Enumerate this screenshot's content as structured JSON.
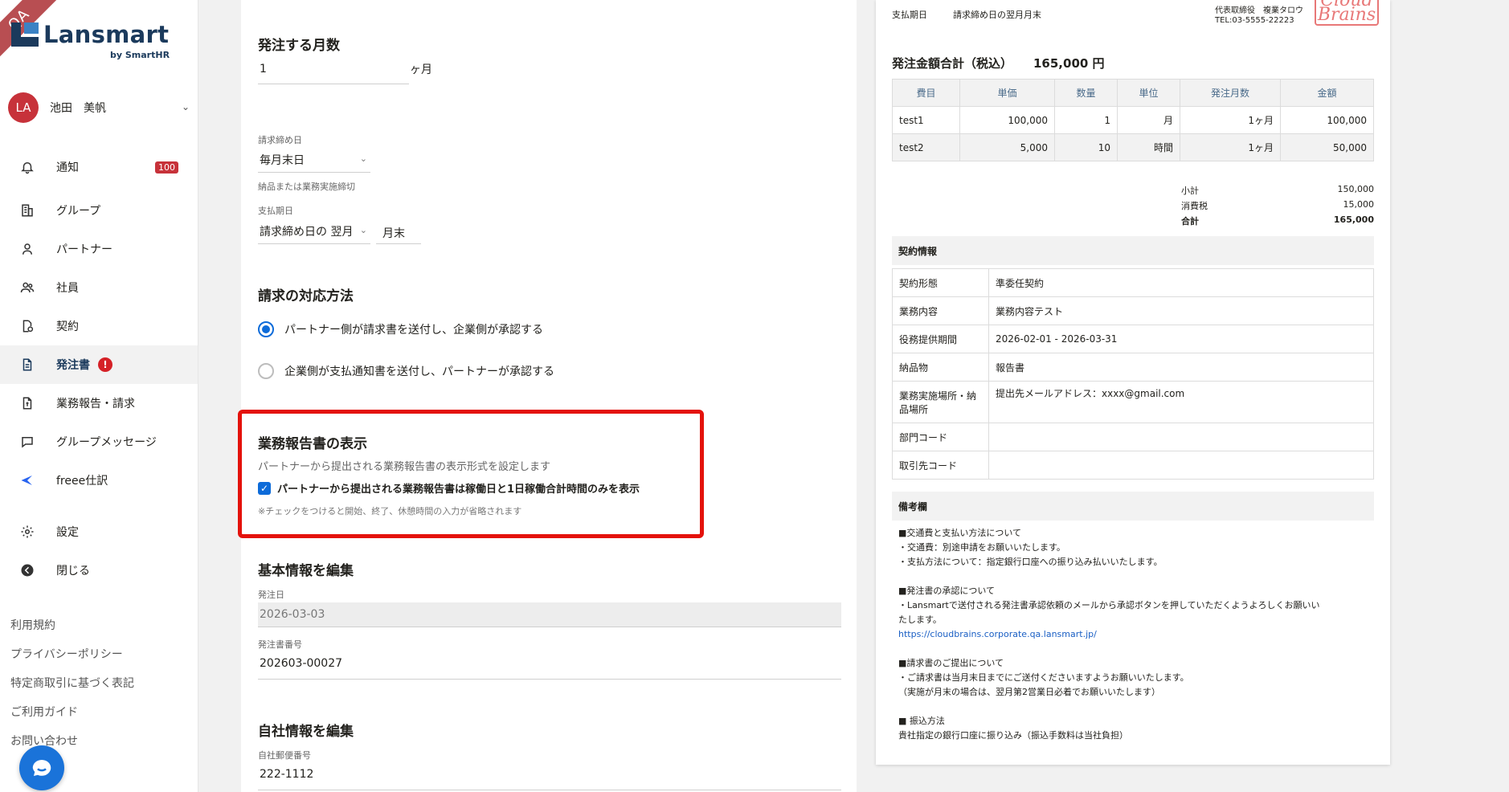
{
  "env_label": "QA",
  "app": {
    "logo_text": "Lansmart",
    "logo_sub": "by SmartHR"
  },
  "user": {
    "initials": "LA",
    "name": "池田　美帆"
  },
  "sidebar": {
    "items": [
      {
        "label": "通知",
        "icon": "bell-icon",
        "badge": "100"
      },
      {
        "label": "グループ",
        "icon": "building-icon"
      },
      {
        "label": "パートナー",
        "icon": "person-icon"
      },
      {
        "label": "社員",
        "icon": "people-icon"
      },
      {
        "label": "契約",
        "icon": "contract-icon"
      },
      {
        "label": "発注書",
        "icon": "document-icon",
        "badge": "!"
      },
      {
        "label": "業務報告・請求",
        "icon": "invoice-icon"
      },
      {
        "label": "グループメッセージ",
        "icon": "chat-icon"
      },
      {
        "label": "freee仕訳",
        "icon": "freee-icon"
      },
      {
        "label": "設定",
        "icon": "gear-icon"
      },
      {
        "label": "閉じる",
        "icon": "collapse-icon"
      }
    ],
    "footer_links": [
      "利用規約",
      "プライバシーポリシー",
      "特定商取引に基づく表記",
      "ご利用ガイド",
      "お問い合わせ"
    ]
  },
  "form": {
    "months": {
      "title": "発注する月数",
      "value": "1",
      "unit": "ヶ月"
    },
    "closing": {
      "label": "請求締め日",
      "value": "毎月末日",
      "hint": "納品または業務実施締切"
    },
    "payment": {
      "label": "支払期日",
      "value": "請求締め日の 翌月",
      "day": "月末"
    },
    "invoice_method": {
      "title": "請求の対応方法",
      "option1": "パートナー側が請求書を送付し、企業側が承認する",
      "option2": "企業側が支払通知書を送付し、パートナーが承認する"
    },
    "report_display": {
      "title": "業務報告書の表示",
      "desc": "パートナーから提出される業務報告書の表示形式を設定します",
      "checkbox_label": "パートナーから提出される業務報告書は稼働日と1日稼働合計時間のみを表示",
      "note": "※チェックをつけると開始、終了、休憩時間の入力が省略されます"
    },
    "basic": {
      "title": "基本情報を編集",
      "order_date_label": "発注日",
      "order_date": "2026-03-03",
      "order_no_label": "発注書番号",
      "order_no": "202603-00027"
    },
    "company": {
      "title": "自社情報を編集",
      "zip_label": "自社郵便番号",
      "zip": "222-1112"
    }
  },
  "preview": {
    "payment_label": "支払期日",
    "payment_value": "請求締め日の翌月月末",
    "rep": "代表取締役　複業タロウ",
    "tel": "TEL:03-5555-22223",
    "stamp_text": "Cloud Brains",
    "total_label": "発注金額合計（税込）",
    "total_value": "165,000 円",
    "table_headers": [
      "費目",
      "単価",
      "数量",
      "単位",
      "発注月数",
      "金額"
    ],
    "table_rows": [
      [
        "test1",
        "100,000",
        "1",
        "月",
        "1ヶ月",
        "100,000"
      ],
      [
        "test2",
        "5,000",
        "10",
        "時間",
        "1ヶ月",
        "50,000"
      ]
    ],
    "subtotal_label": "小計",
    "subtotal": "150,000",
    "tax_label": "消費税",
    "tax": "15,000",
    "sum_label": "合計",
    "sum": "165,000",
    "contract_head": "契約情報",
    "contract_rows": [
      [
        "契約形態",
        "準委任契約"
      ],
      [
        "業務内容",
        "業務内容テスト"
      ],
      [
        "役務提供期間",
        "2026-02-01 - 2026-03-31"
      ],
      [
        "納品物",
        "報告書"
      ],
      [
        "業務実施場所・納品場所",
        "提出先メールアドレス：xxxx@gmail.com"
      ],
      [
        "部門コード",
        ""
      ],
      [
        "取引先コード",
        ""
      ]
    ],
    "notes_head": "備考欄",
    "notes_lines": [
      "■交通費と支払い方法について",
      "・交通費：別途申請をお願いいたします。",
      "・支払方法について：指定銀行口座への振り込み払いいたします。",
      "",
      "■発注書の承認について",
      "・Lansmartで送付される発注書承認依頼のメールから承認ボタンを押していただくようよろしくお願いい",
      "たします。",
      "https://cloudbrains.corporate.qa.lansmart.jp/",
      "",
      "■請求書のご提出について",
      "・ご請求書は当月末日までにご送付くださいますようお願いいたします。",
      "（実施が月末の場合は、翌月第2営業日必着でお願いいたします）",
      "",
      "■ 振込方法",
      "貴社指定の銀行口座に振り込み（振込手数料は当社負担）"
    ]
  }
}
